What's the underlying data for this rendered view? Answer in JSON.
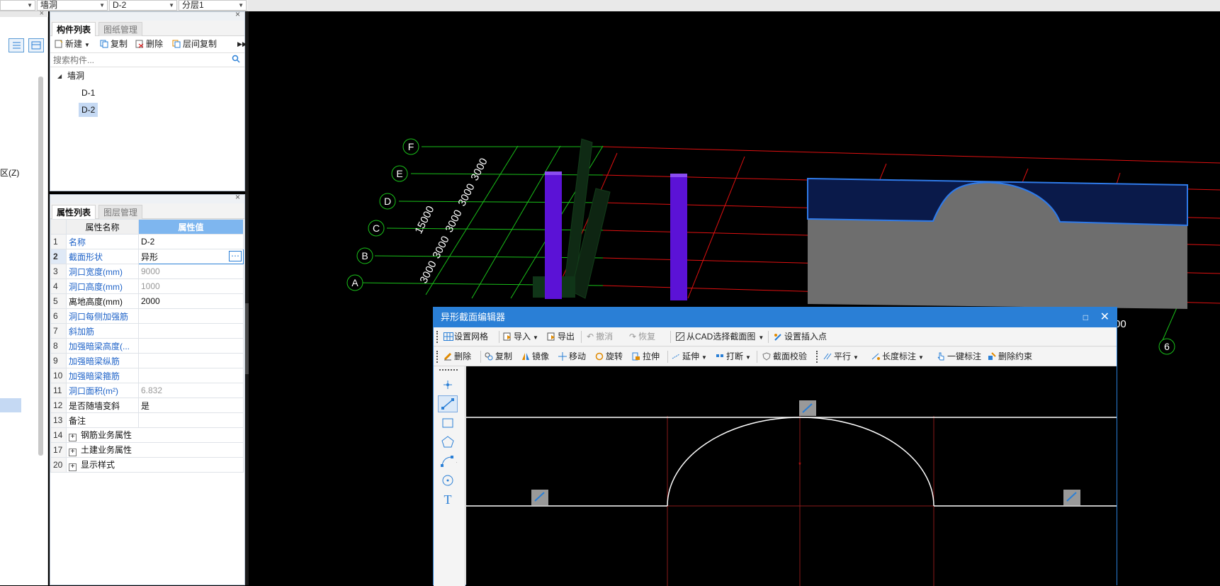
{
  "top_selectors": [
    {
      "value": "墙洞"
    },
    {
      "value": "D-2"
    },
    {
      "value": "分层1"
    }
  ],
  "left_strip": {
    "label": "区(Z)"
  },
  "component_panel": {
    "tabs": [
      "构件列表",
      "图纸管理"
    ],
    "toolbar": {
      "new": "新建",
      "copy": "复制",
      "delete": "删除",
      "floor_copy": "层间复制"
    },
    "search_placeholder": "搜索构件...",
    "tree": {
      "root": "墙洞",
      "items": [
        "D-1",
        "D-2"
      ]
    }
  },
  "property_panel": {
    "tabs": [
      "属性列表",
      "图层管理"
    ],
    "header": {
      "name": "属性名称",
      "value": "属性值"
    },
    "rows": [
      {
        "idx": "1",
        "name": "名称",
        "value": "D-2",
        "name_style": "blue",
        "value_style": ""
      },
      {
        "idx": "2",
        "name": "截面形状",
        "value": "异形",
        "name_style": "blue",
        "value_style": "edit"
      },
      {
        "idx": "3",
        "name": "洞口宽度(mm)",
        "value": "9000",
        "name_style": "blue",
        "value_style": "gray"
      },
      {
        "idx": "4",
        "name": "洞口高度(mm)",
        "value": "1000",
        "name_style": "blue",
        "value_style": "gray"
      },
      {
        "idx": "5",
        "name": "离地高度(mm)",
        "value": "2000",
        "name_style": "",
        "value_style": ""
      },
      {
        "idx": "6",
        "name": "洞口每侧加强筋",
        "value": "",
        "name_style": "blue",
        "value_style": ""
      },
      {
        "idx": "7",
        "name": "斜加筋",
        "value": "",
        "name_style": "blue",
        "value_style": ""
      },
      {
        "idx": "8",
        "name": "加强暗梁高度(...",
        "value": "",
        "name_style": "blue",
        "value_style": ""
      },
      {
        "idx": "9",
        "name": "加强暗梁纵筋",
        "value": "",
        "name_style": "blue",
        "value_style": ""
      },
      {
        "idx": "10",
        "name": "加强暗梁箍筋",
        "value": "",
        "name_style": "blue",
        "value_style": ""
      },
      {
        "idx": "11",
        "name": "洞口面积(m²)",
        "value": "6.832",
        "name_style": "blue",
        "value_style": "gray"
      },
      {
        "idx": "12",
        "name": "是否随墙变斜",
        "value": "是",
        "name_style": "",
        "value_style": ""
      },
      {
        "idx": "13",
        "name": "备注",
        "value": "",
        "name_style": "",
        "value_style": ""
      },
      {
        "idx": "14",
        "name": "钢筋业务属性",
        "value": "",
        "name_style": "group",
        "value_style": ""
      },
      {
        "idx": "17",
        "name": "土建业务属性",
        "value": "",
        "name_style": "group",
        "value_style": ""
      },
      {
        "idx": "20",
        "name": "显示样式",
        "value": "",
        "name_style": "group",
        "value_style": ""
      }
    ]
  },
  "viewport": {
    "axis_labels_rows": [
      "F",
      "E",
      "D",
      "C",
      "B",
      "A"
    ],
    "axis_label_col": "6",
    "dims_vertical": [
      "3000",
      "3000",
      "3000",
      "3000",
      "3000"
    ],
    "dim_total": "15000",
    "dims_bottom": [
      "3000",
      "3000",
      "00"
    ]
  },
  "editor": {
    "title": "异形截面编辑器",
    "toolbar1": {
      "grid": "设置网格",
      "import": "导入",
      "export": "导出",
      "undo": "撤消",
      "redo": "恢复",
      "cad": "从CAD选择截面图",
      "insert": "设置插入点"
    },
    "toolbar2": {
      "delete": "删除",
      "copy": "复制",
      "mirror": "镜像",
      "move": "移动",
      "rotate": "旋转",
      "stretch": "拉伸",
      "extend": "延伸",
      "break": "打断",
      "check": "截面校验",
      "parallel": "平行",
      "length_dim": "长度标注",
      "auto_dim": "一键标注",
      "del_constraint": "删除约束"
    },
    "tools": [
      "point-tool",
      "line-tool",
      "rect-tool",
      "polygon-tool",
      "arc-tool",
      "circle-tool",
      "text-tool"
    ],
    "text_tool_glyph": "T"
  },
  "colors": {
    "accent": "#2a7fd6",
    "grid_green": "#19c019",
    "grid_red": "#e01010",
    "column_purple": "#5b12d6",
    "selection_blue": "#2f7ae8"
  }
}
